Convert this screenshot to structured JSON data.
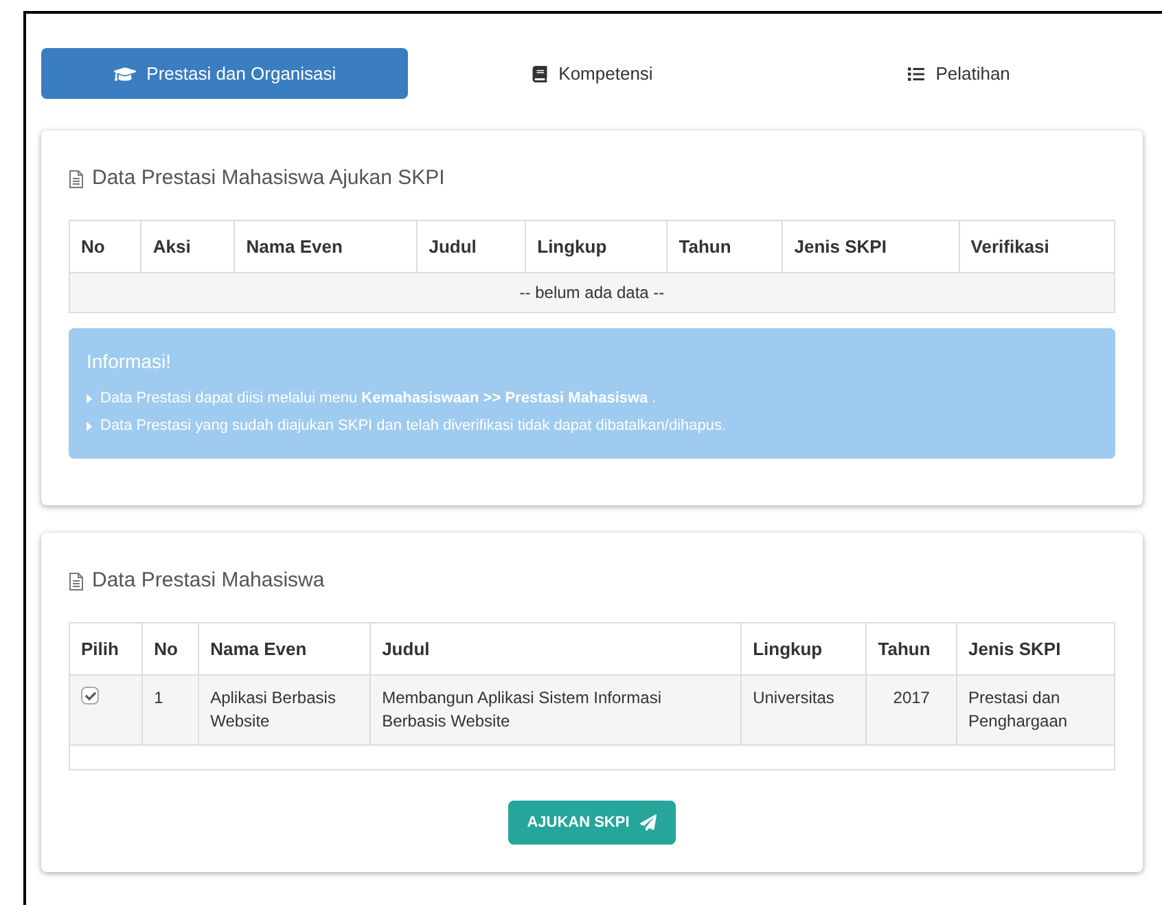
{
  "tabs": [
    {
      "label": "Prestasi dan Organisasi",
      "kind": "graduation",
      "selected": true
    },
    {
      "label": "Kompetensi",
      "kind": "book",
      "selected": false
    },
    {
      "label": "Pelatihan",
      "kind": "list",
      "selected": false
    }
  ],
  "submission_panel": {
    "title": "Data Prestasi Mahasiswa Ajukan SKPI",
    "table": {
      "columns": [
        "No",
        "Aksi",
        "Nama Even",
        "Judul",
        "Lingkup",
        "Tahun",
        "Jenis SKPI",
        "Verifikasi"
      ],
      "empty_text": "-- belum ada data --"
    },
    "info": {
      "title": "Informasi!",
      "items": [
        "Data Prestasi dapat diisi melalui menu **Kemahasiswaan >> Prestasi Mahasiswa** .",
        "Data Prestasi yang sudah diajukan SKPI dan telah diverifikasi tidak dapat dibatalkan/dihapus."
      ]
    }
  },
  "achievements_panel": {
    "title": "Data Prestasi Mahasiswa",
    "table": {
      "columns": [
        "Pilih",
        "No",
        "Nama Even",
        "Judul",
        "Lingkup",
        "Tahun",
        "Jenis SKPI"
      ],
      "rows": [
        {
          "cells": [
            {
              "kind": "checkbox",
              "checked": true
            },
            {
              "text": "1"
            },
            {
              "text": "Aplikasi Berbasis Website"
            },
            {
              "text": "Membangun Aplikasi Sistem Informasi Berbasis Website"
            },
            {
              "text": "Universitas"
            },
            {
              "text": "2017"
            },
            {
              "text": "Prestasi dan Penghargaan"
            }
          ]
        }
      ]
    },
    "button": "AJUKAN SKPI"
  }
}
